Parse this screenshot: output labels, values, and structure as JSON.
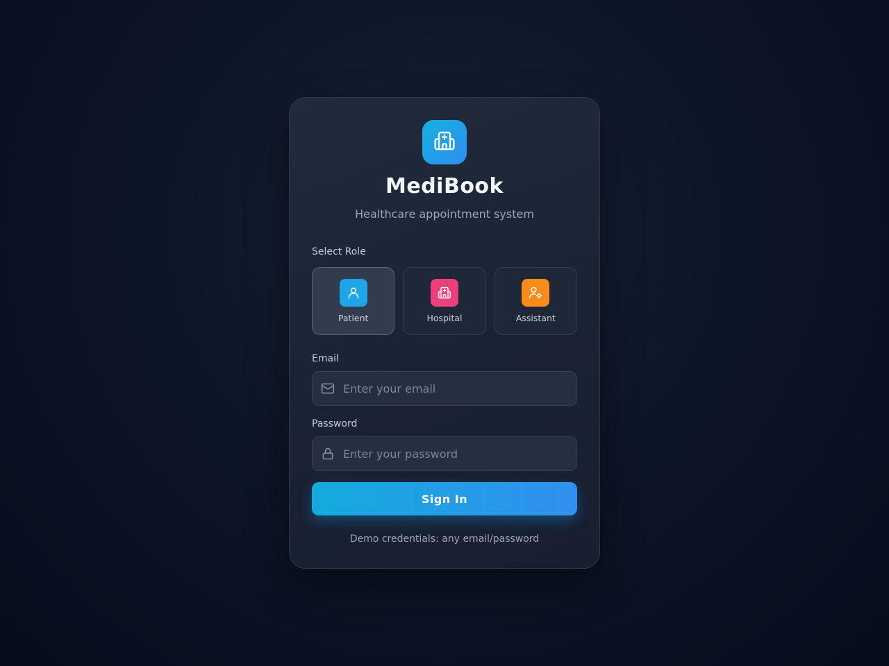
{
  "app": {
    "name": "MediBook",
    "subtitle": "Healthcare appointment system",
    "logo_icon": "hospital-icon"
  },
  "roles": {
    "label": "Select Role",
    "selected": "Patient",
    "items": [
      {
        "label": "Patient",
        "icon": "user-icon",
        "color": "#1ea6e8"
      },
      {
        "label": "Hospital",
        "icon": "hospital-icon",
        "color": "#ec407a"
      },
      {
        "label": "Assistant",
        "icon": "user-cog-icon",
        "color": "#fb8c1a"
      }
    ]
  },
  "email": {
    "label": "Email",
    "placeholder": "Enter your email",
    "value": "",
    "icon": "mail-icon"
  },
  "password": {
    "label": "Password",
    "placeholder": "Enter your password",
    "value": "",
    "icon": "lock-icon"
  },
  "signin": {
    "label": "Sign In"
  },
  "demo_note": "Demo credentials: any email/password",
  "colors": {
    "accent_start": "#14abde",
    "accent_end": "#3190ee"
  }
}
